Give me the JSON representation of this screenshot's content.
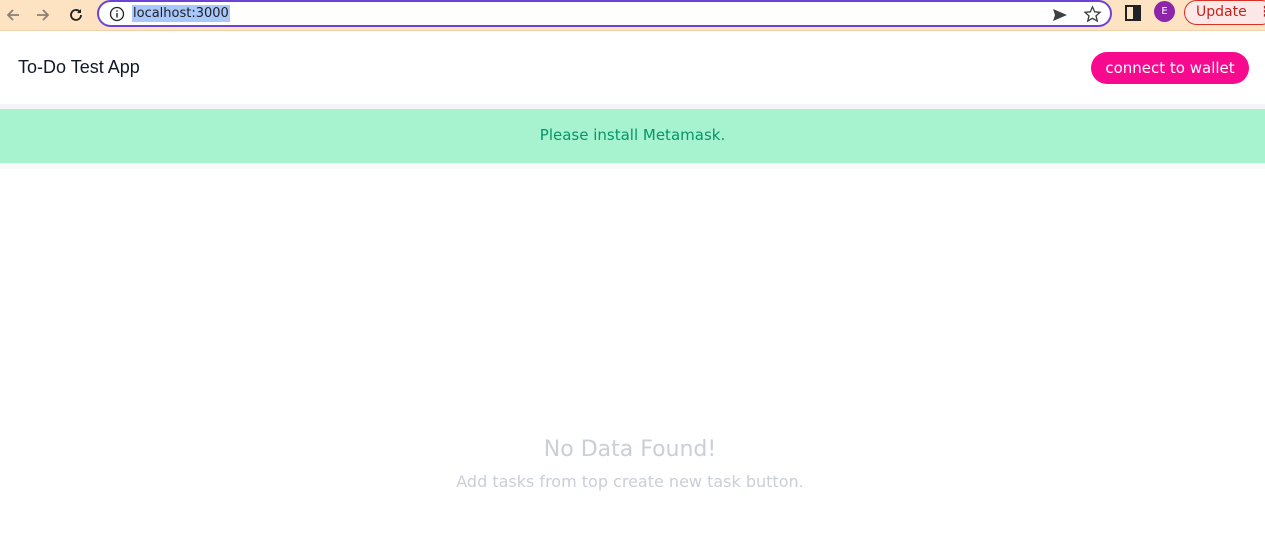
{
  "browser": {
    "url": "localhost:3000",
    "avatar_initial": "E",
    "update_label": "Update",
    "menu_glyph": "⋮",
    "icons": [
      "back-arrow-icon",
      "forward-arrow-icon",
      "reload-icon",
      "info-icon",
      "send-icon",
      "star-icon",
      "side-panel-icon"
    ]
  },
  "app": {
    "title": "To-Do Test App",
    "connect_label": "connect to wallet",
    "alert_message": "Please install Metamask.",
    "empty_title": "No Data Found!",
    "empty_subtitle": "Add tasks from top create new task button.",
    "colors": {
      "accent": "#f70a8d",
      "alert_bg": "#a7f3d0",
      "alert_text": "#059669",
      "muted": "#c9cfd8"
    }
  }
}
